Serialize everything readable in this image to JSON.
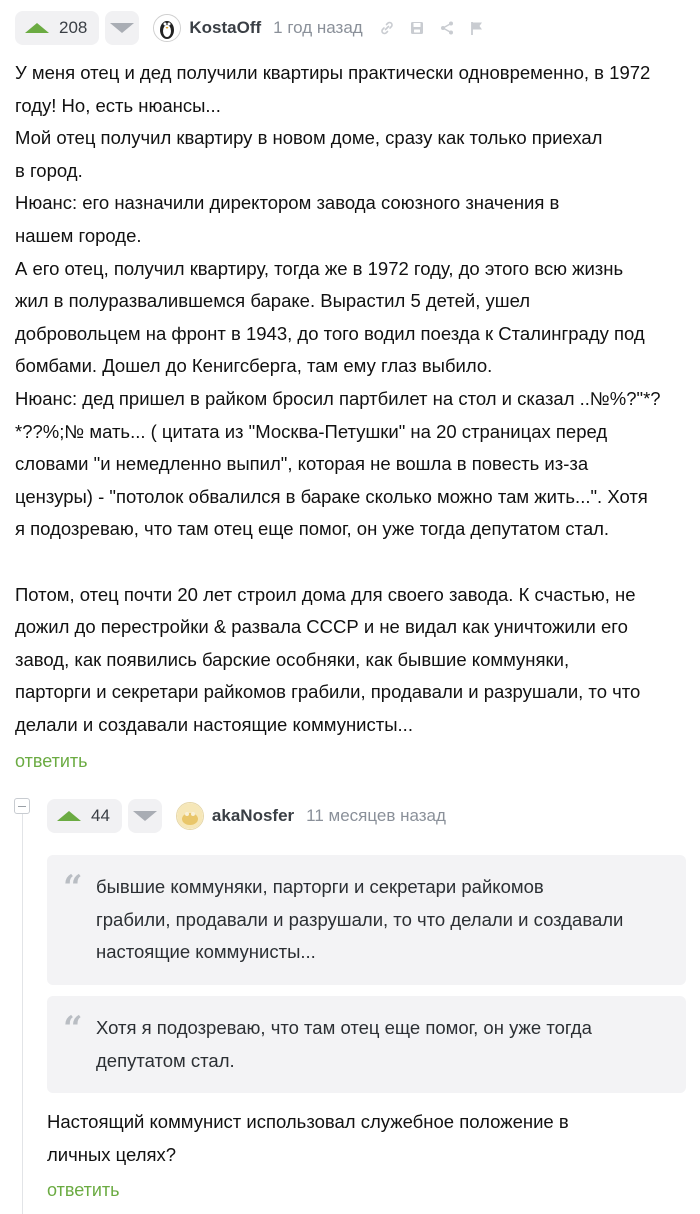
{
  "comment": {
    "rating": "208",
    "username": "KostaOff",
    "time": "1 год назад",
    "text": "У меня отец и дед получили квартиры практически одновременно, в 1972\nгоду! Но, есть нюансы...\nМой отец получил квартиру в новом доме, сразу как только приехал\nв город.\nНюанс: его назначили директором завода союзного значения в\nнашем городе.\nА его отец, получил квартиру, тогда же в 1972 году, до этого всю жизнь\nжил в  полуразвалившемся бараке. Вырастил 5 детей, ушел\nдобровольцем на фронт в 1943, до того водил поезда к Сталинграду под\nбомбами. Дошел до Кенигсберга, там ему глаз выбило.\nНюанс: дед пришел в райком бросил партбилет на стол и сказал ..№%?\"*?\n*??%;№ мать... ( цитата из \"Москва-Петушки\" на 20 страницах перед\nсловами \"и немедленно выпил\", которая не вошла в повесть из-за\nцензуры)  - \"потолок обвалился в бараке сколько можно там жить...\". Хотя\nя подозреваю, что там отец еще помог, он уже тогда депутатом стал.\n\nПотом, отец почти 20 лет строил дома для своего завода. К счастью, не\nдожил до перестройки & развала СССР и не видал как уничтожили его\nзавод, как появились барские особняки, как бывшие коммуняки,\nпарторги и секретари райкомов грабили, продавали и разрушали, то что\nделали и создавали  настоящие коммунисты...",
    "reply_label": "ответить"
  },
  "reply": {
    "rating": "44",
    "username": "akaNosfer",
    "time": "11 месяцев назад",
    "quotes": [
      "бывшие коммуняки, парторги и секретари райкомов\nграбили, продавали и разрушали, то что делали и создавали\nнастоящие коммунисты...",
      "Хотя я подозреваю, что там отец еще помог, он уже тогда\nдепутатом стал."
    ],
    "text": "Настоящий коммунист использовал служебное положение в\nличных целях?",
    "reply_label": "ответить"
  },
  "icons": {
    "upvote": "arrow-up-icon",
    "downvote": "arrow-down-icon",
    "link": "link-icon",
    "save": "save-icon",
    "share": "share-icon",
    "report": "flag-icon",
    "quote": "quote-icon",
    "collapse": "collapse-icon"
  },
  "colors": {
    "accent_green": "#6bab42",
    "muted": "#8a9099",
    "quote_bg": "#f3f3f5"
  }
}
